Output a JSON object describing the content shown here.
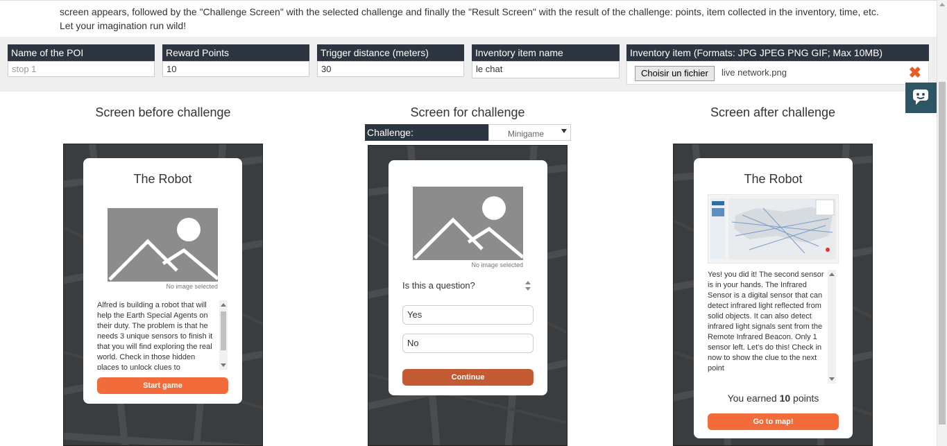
{
  "intro": {
    "text": "screen appears, followed by the \"Challenge Screen\" with the selected challenge and finally the \"Result Screen\" with the result of the challenge: points, item collected in the inventory, time, etc. Let your imagination run wild!"
  },
  "fields": {
    "poi_name": {
      "label": "Name of the POI",
      "placeholder": "stop 1"
    },
    "reward_points": {
      "label": "Reward Points",
      "value": "10"
    },
    "trigger_distance": {
      "label": "Trigger distance (meters)",
      "value": "30"
    },
    "inventory_name": {
      "label": "Inventory item name",
      "value": "le chat"
    },
    "inventory_file": {
      "label": "Inventory item (Formats: JPG JPEG PNG GIF; Max 10MB)",
      "button": "Choisir un fichier",
      "filename": "live network.png",
      "remove_icon": "close-icon"
    }
  },
  "chat_icon": "chat-bubble-icon",
  "columns": {
    "before": {
      "title": "Screen before challenge",
      "card_title": "The Robot",
      "no_image": "No image selected",
      "text": "Alfred is building a robot that will help the Earth Special Agents on their duty. The problem is that he needs 3 unique sensors to finish it that you will find exploring the real world. Check in those hidden places to unlock clues to",
      "button": "Start game"
    },
    "challenge": {
      "title": "Screen for challenge",
      "challenge_label": "Challenge:",
      "challenge_value": "Minigame",
      "no_image": "No image selected",
      "question": "Is this a question?",
      "answers": [
        "Yes",
        "No"
      ],
      "button": "Continue"
    },
    "after": {
      "title": "Screen after challenge",
      "card_title": "The Robot",
      "text": "Yes! you did it! The second sensor is in your hands. The Infrared Sensor is a digital sensor that can detect infrared light reflected from solid objects. It can also detect infrared light signals sent from the Remote Infrared Beacon. Only 1 sensor left. Let's do this! Check in now to show the clue to the next point",
      "earned_prefix": "You earned",
      "earned_points": "10",
      "earned_suffix": "points",
      "button": "Go to map!"
    }
  },
  "colors": {
    "dark_label": "#2d3540",
    "accent_orange": "#f26b3a",
    "continue_orange": "#c45a33",
    "chat_widget": "#2d5564",
    "remove_red": "#e85c2c"
  }
}
